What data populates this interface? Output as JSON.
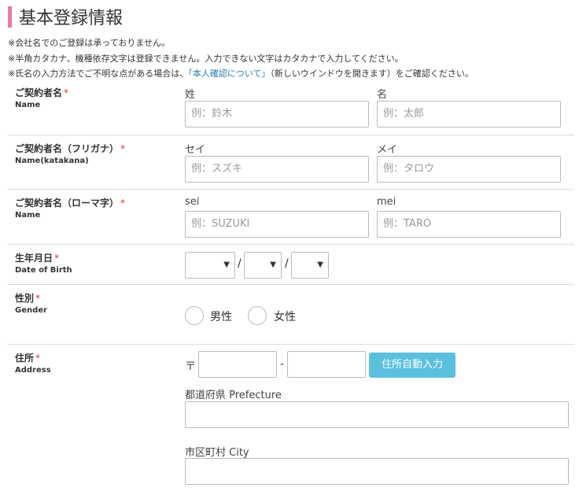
{
  "page": {
    "title": "基本登録情報",
    "notes": [
      "※会社名でのご登録は承っておりません。",
      "※半角カタカナ、機種依存文字は登録できません。入力できない文字はカタカナで入力してください。"
    ],
    "note3_pre": "※氏名の入力方法でご不明な点がある場合は、",
    "note3_link": "「本人確認について」",
    "note3_post": "（新しいウインドウを開きます）をご確認ください。"
  },
  "form": {
    "required_mark": "*",
    "name": {
      "label": "ご契約者名",
      "label_en": "Name",
      "sub_last": "姓",
      "sub_first": "名",
      "ph_last": "例：鈴木",
      "ph_first": "例：太郎"
    },
    "kana": {
      "label": "ご契約者名（フリガナ）",
      "label_en": "Name(katakana)",
      "sub_last": "セイ",
      "sub_first": "メイ",
      "ph_last": "例：スズキ",
      "ph_first": "例：タロウ"
    },
    "roman": {
      "label": "ご契約者名（ローマ字）",
      "label_en": "Name",
      "sub_last": "sei",
      "sub_first": "mei",
      "ph_last": "例：SUZUKI",
      "ph_first": "例：TARO"
    },
    "dob": {
      "label": "生年月日",
      "label_en": "Date of Birth",
      "sep": "/",
      "arrow": "▼"
    },
    "gender": {
      "label": "性別",
      "label_en": "Gender",
      "male": "男性",
      "female": "女性"
    },
    "address": {
      "label": "住所",
      "label_en": "Address",
      "postal_mark": "〒",
      "dash": "-",
      "autofill_button": "住所自動入力",
      "prefecture_label": "都道府県 Prefecture",
      "city_label": "市区町村 City"
    }
  }
}
